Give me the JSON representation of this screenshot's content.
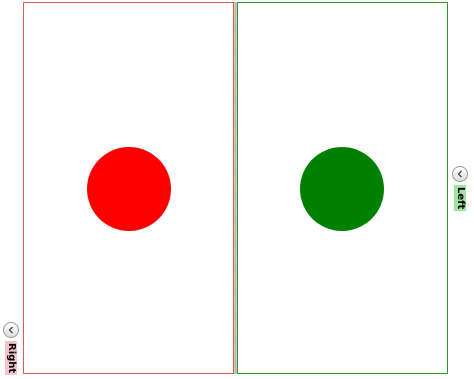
{
  "panels": {
    "left": {
      "circle_color": "#ff0000",
      "border_color": "#e05a5a"
    },
    "right": {
      "circle_color": "#008000",
      "border_color": "#2e9a2e"
    }
  },
  "collapsed_tabs": {
    "right": {
      "label": "Right",
      "icon": "chevron-left-icon",
      "background": "#f6c4cc"
    },
    "left": {
      "label": "Left",
      "icon": "chevron-left-icon",
      "background": "#9fe59f"
    }
  }
}
